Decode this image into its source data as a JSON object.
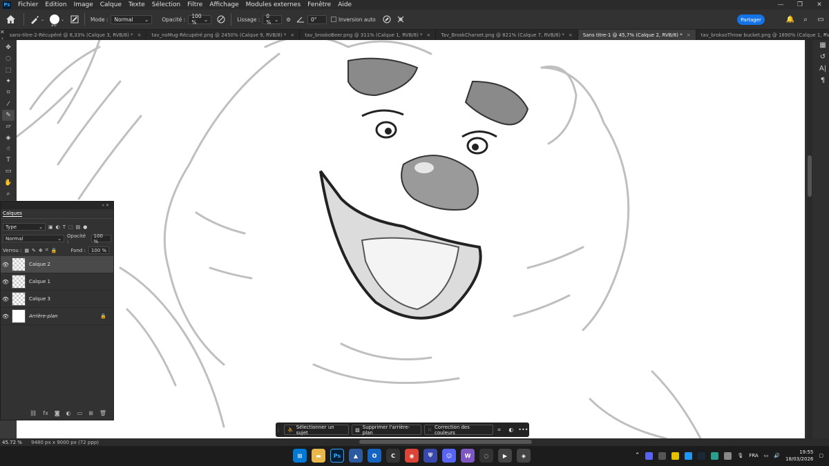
{
  "menubar": {
    "logo": "Ps",
    "items": [
      "Fichier",
      "Edition",
      "Image",
      "Calque",
      "Texte",
      "Sélection",
      "Filtre",
      "Affichage",
      "Modules externes",
      "Fenêtre",
      "Aide"
    ]
  },
  "options": {
    "brush_size": "20",
    "mode_label": "Mode :",
    "mode_value": "Normal",
    "opacity_label": "Opacité :",
    "opacity_value": "100 %",
    "smoothing_label": "Lissage :",
    "smoothing_value": "0 %",
    "angle_value": "0°",
    "auto_invert_label": "Inversion auto",
    "share_label": "Partager"
  },
  "tabs": [
    {
      "label": "sans-titre-2-Récupéré @ 8,33% (Calque 3, RVB/8) *",
      "active": false
    },
    {
      "label": "tav_noMug-Récupéré.png @ 2450% (Calque 9, RVB/8) *",
      "active": false
    },
    {
      "label": "tav_broskoBeer.png @ 311% (Calque 1, RVB/8) *",
      "active": false
    },
    {
      "label": "Tav_BroskCharset.png @ 821% (Calque 7, RVB/8) *",
      "active": false
    },
    {
      "label": "Sans titre-1 @ 45,7% (Calque 2, RVB/8) *",
      "active": true
    },
    {
      "label": "tav_broksoThrow bucket.png @ 1890% (Calque 1, RVB/8) *",
      "active": false
    }
  ],
  "layers_panel": {
    "title": "Calques",
    "filter_value": "Type",
    "blend_mode": "Normal",
    "opacity_label": "Opacité :",
    "opacity_value": "100 %",
    "lock_label": "Verrou :",
    "fill_label": "Fond :",
    "fill_value": "100 %",
    "layers": [
      {
        "name": "Calque 2",
        "active": true
      },
      {
        "name": "Calque 1",
        "active": false
      },
      {
        "name": "Calque 3",
        "active": false
      },
      {
        "name": "Arrière-plan",
        "active": false
      }
    ]
  },
  "context_bar": {
    "select_subject": "Sélectionner un sujet",
    "remove_bg": "Supprimer l'arrière-plan",
    "color_correction": "Correction des couleurs"
  },
  "status": {
    "zoom": "45.72 %",
    "doc_info": "9480 px x 9000 px (72 ppp)"
  },
  "taskbar": {
    "lang": "FRA",
    "time": "19:55",
    "date": "18/03/2026"
  }
}
